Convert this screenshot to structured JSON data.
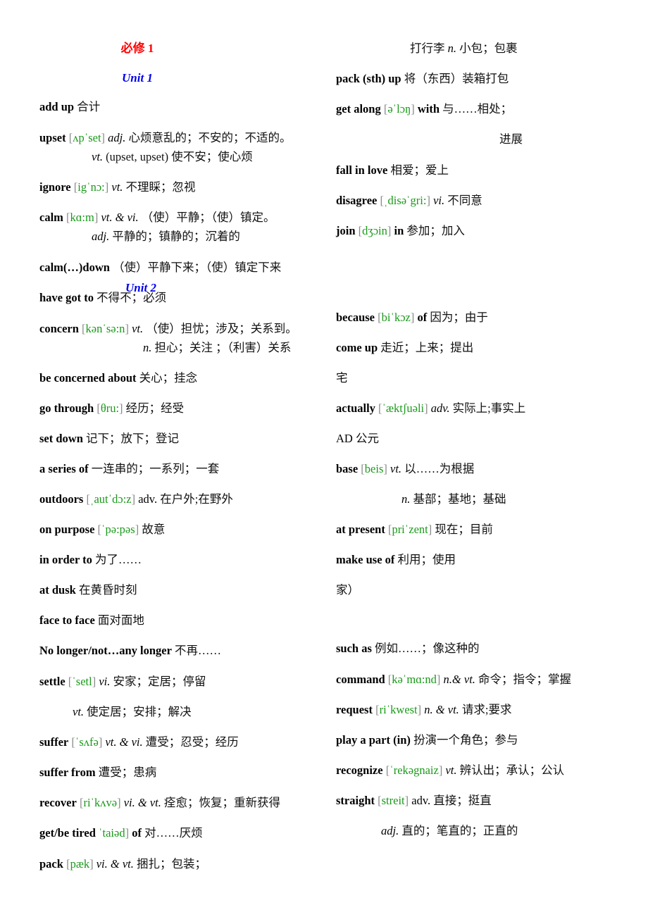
{
  "document": {
    "book_title": "必修 1",
    "left_column": {
      "unit1_heading": "Unit 1",
      "entries": [
        {
          "headword": "add up",
          "definition": "合计"
        },
        {
          "headword": "upset",
          "phonetic": "ʌpˈset",
          "pos": "adj.",
          "definition": "心烦意乱的；不安的；不适的。",
          "sub": {
            "pos": "vt.",
            "definition": "(upset, upset)  使不安；使心烦"
          }
        },
        {
          "headword": "ignore",
          "phonetic": "igˈnɔ:",
          "pos": "vt.",
          "definition": "不理睬；忽视"
        },
        {
          "headword": "calm",
          "phonetic": "kɑ:m",
          "pos": "vt. & vi.",
          "definition": "（使）平静；（使）镇定。",
          "sub": {
            "pos": "adj.",
            "definition": "平静的；镇静的；沉着的"
          }
        },
        {
          "headword": "calm(…)down",
          "definition": "（使）平静下来；（使）镇定下来"
        },
        {
          "headword": "have got to",
          "definition": "不得不；必须"
        },
        {
          "headword": "concern",
          "phonetic": "kənˈsə:n",
          "pos": "vt.",
          "definition": "（使）担忧；涉及；关系到。",
          "sub": {
            "pos": "n.",
            "definition": "担心；关注 ；（利害）关系"
          }
        },
        {
          "headword": "be concerned about",
          "definition": "关心；挂念"
        },
        {
          "headword": "go through",
          "phonetic": "θru:",
          "definition": "经历；经受"
        },
        {
          "headword": "set down",
          "definition": "记下；放下；登记"
        },
        {
          "headword": "a series of",
          "definition": "一连串的；一系列；一套"
        },
        {
          "headword": "outdoors",
          "phonetic": "ˌautˈdɔ:z",
          "pos": "adv.",
          "definition": "在户外;在野外"
        },
        {
          "headword": "on purpose",
          "phonetic": "ˈpə:pəs",
          "definition": "故意"
        },
        {
          "headword": "in order to",
          "definition": "为了……"
        },
        {
          "headword": "at dusk",
          "definition": "在黄昏时刻"
        },
        {
          "headword": "face to face",
          "definition": "面对面地"
        },
        {
          "headword": "No longer/not…any longer",
          "definition": "不再……"
        },
        {
          "headword": "settle",
          "phonetic": "ˈsetl",
          "pos": "vi.",
          "definition": "安家；定居；停留",
          "sub": {
            "pos": "vt.",
            "definition": "使定居；安排；解决"
          }
        },
        {
          "headword": "suffer",
          "phonetic": "ˈsʌfə",
          "pos": "vt. & vi.",
          "definition": "遭受；忍受；经历"
        },
        {
          "headword": "suffer from",
          "definition": "遭受；患病"
        },
        {
          "headword": "recover",
          "phonetic": "riˈkʌvə",
          "pos": "vi. & vt.",
          "definition": "痊愈；恢复；重新获得"
        },
        {
          "headword": "get/be tired",
          "phonetic": "ˈtaiəd",
          "headword_tail": "of",
          "definition": "对……厌烦"
        },
        {
          "headword": "pack",
          "phonetic": "pæk",
          "pos": "vi. & vt.",
          "definition": "捆扎；包装；"
        }
      ]
    },
    "right_column": {
      "continuation": {
        "prefix": "打行李",
        "pos": "n.",
        "definition": "小包；包裹"
      },
      "entries_before_unit2": [
        {
          "headword": "pack (sth) up",
          "definition": "将（东西）装箱打包"
        },
        {
          "headword": "get along",
          "phonetic": "əˈlɔŋ",
          "headword_tail": "with",
          "definition": "与……相处；",
          "continuation": "进展"
        },
        {
          "headword": "fall in love",
          "definition": "相爱；爱上"
        },
        {
          "headword": "disagree",
          "phonetic": "ˌdisəˈgri:",
          "pos": "vi.",
          "definition": "不同意"
        },
        {
          "headword": "join",
          "phonetic": "dʒɔin",
          "headword_tail": "in",
          "definition": "参加；加入"
        }
      ],
      "unit2_heading": "Unit 2",
      "entries_unit2": [
        {
          "headword": "because",
          "phonetic": "biˈkɔz",
          "headword_tail": "of",
          "definition": "因为；由于"
        },
        {
          "headword": "come up",
          "definition": "走近；上来；提出"
        },
        {
          "fragment": "宅"
        },
        {
          "headword": "actually",
          "phonetic": "ˈæktʃuəli",
          "pos": "adv.",
          "definition": "实际上;事实上"
        },
        {
          "plain": "AD",
          "definition": "公元"
        },
        {
          "headword": "base",
          "phonetic": "beis",
          "pos": "vt.",
          "definition": "以……为根据",
          "sub": {
            "pos": "n.",
            "definition": "基部；基地；基础"
          }
        },
        {
          "headword": "at present",
          "phonetic": "priˈzent",
          "definition": "现在；目前"
        },
        {
          "headword": "make use of",
          "definition": "利用；使用"
        },
        {
          "fragment": "家）"
        },
        {
          "headword": "such as",
          "definition": "例如……；像这种的"
        },
        {
          "headword": "command",
          "phonetic": "kəˈmɑ:nd",
          "pos": "n.& vt.",
          "definition": "命令；指令；掌握"
        },
        {
          "headword": "request",
          "phonetic": "riˈkwest",
          "pos": "n. & vt.",
          "definition": "请求;要求"
        },
        {
          "headword": "play a part (in)",
          "definition": "扮演一个角色；参与"
        },
        {
          "headword": "recognize",
          "phonetic": "ˈrekəgnaiz",
          "pos": "vt.",
          "definition": "辨认出；承认；公认"
        },
        {
          "headword": "straight",
          "phonetic": "streit",
          "pos": "adv.",
          "definition": "直接；挺直",
          "sub": {
            "pos": "adj.",
            "definition": "直的；笔直的；正直的"
          }
        }
      ]
    },
    "colors": {
      "title": "#ff0000",
      "unit_heading": "#0000ee",
      "phonetic": "#1a9a1a",
      "bracket": "#8a8a8a"
    }
  }
}
